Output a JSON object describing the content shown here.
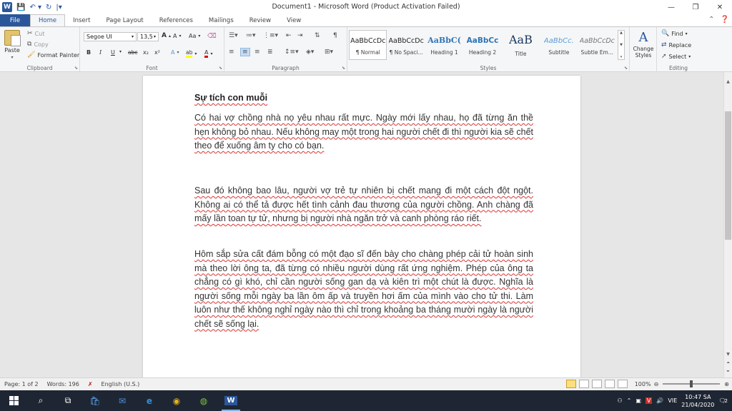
{
  "window": {
    "title": "Document1  -  Microsoft Word (Product Activation Failed)",
    "app_icon": "W",
    "controls": {
      "minimize": "—",
      "restore": "❐",
      "close": "✕"
    }
  },
  "tabs": [
    {
      "label": "File",
      "type": "file"
    },
    {
      "label": "Home",
      "type": "active"
    },
    {
      "label": "Insert",
      "type": "normal"
    },
    {
      "label": "Page Layout",
      "type": "normal"
    },
    {
      "label": "References",
      "type": "normal"
    },
    {
      "label": "Mailings",
      "type": "normal"
    },
    {
      "label": "Review",
      "type": "normal"
    },
    {
      "label": "View",
      "type": "normal"
    }
  ],
  "ribbon": {
    "clipboard": {
      "label": "Clipboard",
      "paste": "Paste",
      "cut": "Cut",
      "copy": "Copy",
      "format_painter": "Format Painter"
    },
    "font": {
      "label": "Font",
      "font_name": "Segoe UI",
      "font_size": "13,5",
      "grow": "A",
      "shrink": "A",
      "case": "Aa",
      "bold": "B",
      "italic": "I",
      "underline": "U",
      "strike": "abc",
      "subscript": "x₂",
      "superscript": "x²",
      "text_effects": "A",
      "highlight": "ab",
      "font_color": "A"
    },
    "paragraph": {
      "label": "Paragraph"
    },
    "styles": {
      "label": "Styles",
      "items": [
        {
          "sample": "AaBbCcDc",
          "name": "¶ Normal",
          "color": "#222222"
        },
        {
          "sample": "AaBbCcDc",
          "name": "¶ No Spaci...",
          "color": "#222222"
        },
        {
          "sample": "AaBbC(",
          "name": "Heading 1",
          "color": "#2e74b5"
        },
        {
          "sample": "AaBbCc",
          "name": "Heading 2",
          "color": "#2e74b5"
        },
        {
          "sample": "AaB",
          "name": "Title",
          "color": "#17365d"
        },
        {
          "sample": "AaBbCc.",
          "name": "Subtitle",
          "color": "#5b9bd5"
        },
        {
          "sample": "AaBbCcDc",
          "name": "Subtle Em...",
          "color": "#666666"
        }
      ],
      "change_styles": "Change Styles"
    },
    "editing": {
      "label": "Editing",
      "find": "Find",
      "replace": "Replace",
      "select": "Select"
    }
  },
  "document": {
    "title": "Sự tích con muỗi",
    "paragraphs": [
      "Có hai vợ chồng nhà nọ yêu nhau rất mực. Ngày mới lấy nhau, họ đã từng ăn thề hẹn không bỏ nhau. Nếu không may một trong hai người chết đi thì người kia sẽ chết theo để xuống âm ty cho có bạn.",
      "Sau đó không bao lâu, người vợ trẻ tự nhiên bị chết mang đi một cách đột ngột. Không ai có thể tả được hết tình cảnh đau thương của người chồng. Anh chàng đã mấy lần toan tự tử, nhưng bị người nhà ngăn trở và canh phòng ráo riết.",
      "Hôm sắp sửa cất đám bỗng có một đạo sĩ đến bày cho chàng phép cải tử hoàn sinh mà theo lời ông ta, đã từng có nhiều người dùng rất ứng nghiệm. Phép của ông ta chẳng có gì khó, chỉ cần người sống gan dạ và kiên trì một chút là được. Nghĩa là người sống mỗi ngày ba lần ôm ấp và truyền hơi ấm của mình vào cho tử thi. Làm luôn như thế không nghỉ ngày nào thì chỉ trong khoảng ba tháng mười ngày là người chết sẽ sống lại."
    ]
  },
  "status": {
    "page": "Page: 1 of 2",
    "words": "Words: 196",
    "language": "English (U.S.)",
    "zoom": "100%"
  },
  "taskbar": {
    "language": "VIE",
    "time": "10:47 SA",
    "date": "21/04/2020",
    "notifications": "2"
  }
}
